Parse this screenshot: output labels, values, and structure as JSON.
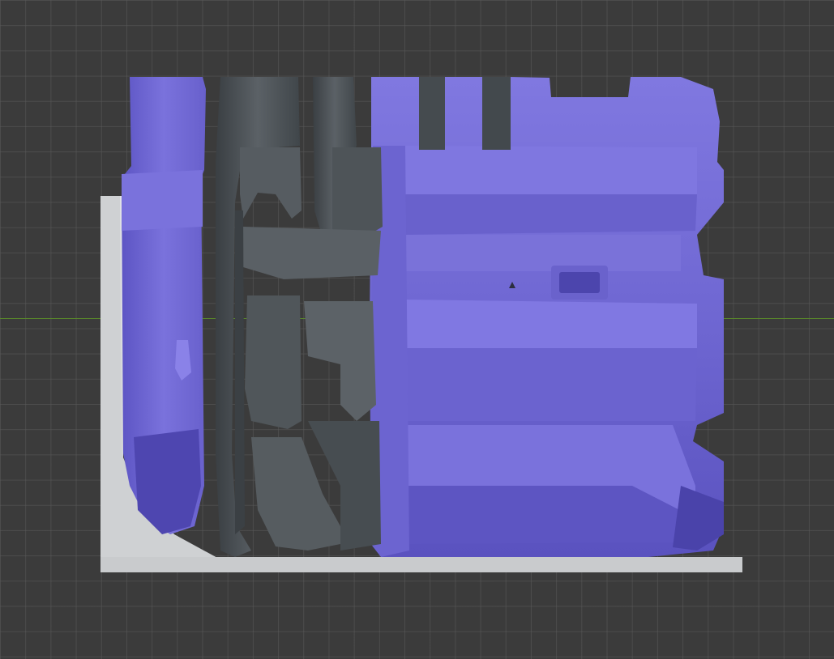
{
  "viewport": {
    "background": "#3b3b3b",
    "grid_color": "#5a5a5a",
    "axis_color": "#5a8a2a",
    "show_grid": true
  },
  "scene": {
    "objects": [
      {
        "name": "support-wall",
        "color": "#d4d6d8"
      },
      {
        "name": "purple-model-part",
        "color": "#7068d0"
      },
      {
        "name": "gray-model-part",
        "color": "#50565a"
      }
    ]
  }
}
